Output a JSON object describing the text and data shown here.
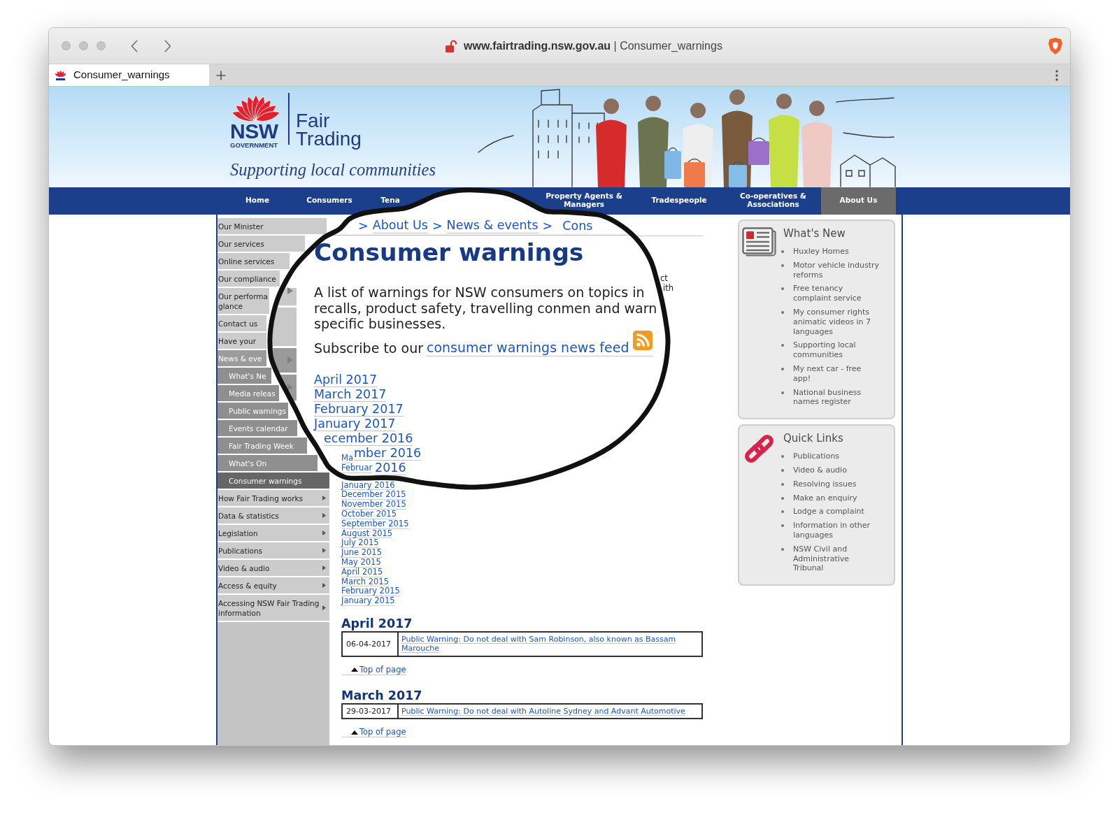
{
  "browser": {
    "address": {
      "domain": "www.fairtrading.nsw.gov.au",
      "separator": "|",
      "page": "Consumer_warnings"
    },
    "tabs": [
      {
        "title": "Consumer_warnings",
        "selected": true
      }
    ]
  },
  "header": {
    "logo_word": "NSW",
    "logo_subword": "GOVERNMENT",
    "agency_name_lines": [
      "Fair",
      "Trading"
    ],
    "tagline": "Supporting local communities"
  },
  "nav": [
    {
      "label": "Home",
      "selected": false
    },
    {
      "label": "Consumers",
      "selected": false
    },
    {
      "label": "Tena",
      "selected": false
    },
    {
      "label": "Property Agents & Managers",
      "selected": false
    },
    {
      "label": "Tradespeople",
      "selected": false
    },
    {
      "label": "Co-operatives & Associations",
      "selected": false
    },
    {
      "label": "About Us",
      "selected": true
    }
  ],
  "sidebar": [
    {
      "label": "Our Minister",
      "selected": false,
      "expanded": false,
      "has_submenu": false
    },
    {
      "label": "Our services",
      "selected": false,
      "expanded": false,
      "has_submenu": false
    },
    {
      "label": "Online services",
      "selected": false,
      "expanded": false,
      "has_submenu": false
    },
    {
      "label": "Our compliance",
      "selected": false,
      "expanded": false,
      "has_submenu": false
    },
    {
      "label": "Our performa\nglance",
      "selected": false,
      "expanded": false,
      "has_submenu": false
    },
    {
      "label": "Contact us",
      "selected": false,
      "expanded": false,
      "has_submenu": false
    },
    {
      "label": "Have your",
      "selected": false,
      "expanded": false,
      "has_submenu": false
    },
    {
      "label": "News & eve",
      "selected": false,
      "expanded": true,
      "has_submenu": false,
      "children": [
        {
          "label": "What's Ne",
          "selected": false
        },
        {
          "label": "Media releas",
          "selected": false
        },
        {
          "label": "Public warnings",
          "selected": false
        },
        {
          "label": "Events calendar",
          "selected": false
        },
        {
          "label": "Fair Trading Week",
          "selected": false
        },
        {
          "label": "What's On",
          "selected": false
        },
        {
          "label": "Consumer warnings",
          "selected": true
        }
      ]
    },
    {
      "label": "How Fair Trading works",
      "selected": false,
      "expanded": false,
      "has_submenu": true
    },
    {
      "label": "Data & statistics",
      "selected": false,
      "expanded": false,
      "has_submenu": true
    },
    {
      "label": "Legislation",
      "selected": false,
      "expanded": false,
      "has_submenu": true
    },
    {
      "label": "Publications",
      "selected": false,
      "expanded": false,
      "has_submenu": true
    },
    {
      "label": "Video & audio",
      "selected": false,
      "expanded": false,
      "has_submenu": true
    },
    {
      "label": "Access & equity",
      "selected": false,
      "expanded": false,
      "has_submenu": true
    },
    {
      "label": "Accessing NSW Fair Trading information",
      "selected": false,
      "expanded": false,
      "has_submenu": true
    }
  ],
  "magnifier": {
    "breadcrumb": [
      {
        "kind": "separator",
        "text": ">"
      },
      {
        "kind": "link",
        "text": "About Us"
      },
      {
        "kind": "separator",
        "text": ">"
      },
      {
        "kind": "link",
        "text": "News & events"
      },
      {
        "kind": "separator",
        "text": ">"
      },
      {
        "kind": "current",
        "text": "Cons"
      }
    ],
    "heading": "Consumer warnings",
    "intro_lines": [
      "A list of warnings for NSW consumers on topics in",
      "recalls, product safety, travelling conmen and warn",
      "specific businesses."
    ],
    "subscribe": {
      "text": "Subscribe to our",
      "link": "consumer warnings news feed"
    },
    "months": [
      "April 2017",
      "March 2017",
      "February 2017",
      "January 2017",
      "ecember 2016",
      "mber 2016",
      "2016"
    ]
  },
  "content": {
    "fragments": [
      "ct",
      "ith"
    ],
    "months": [
      "Ma",
      "Februar",
      "January 2016",
      "December 2015",
      "November 2015",
      "October 2015",
      "September 2015",
      "August 2015",
      "July 2015",
      "June 2015",
      "May 2015",
      "April 2015",
      "March 2015",
      "February 2015",
      "January 2015"
    ],
    "sections": [
      {
        "heading": "April 2017",
        "rows": [
          {
            "date": "06-04-2017",
            "title": "Public Warning: Do not deal with Sam Robinson, also known as Bassam Marouche"
          }
        ],
        "top_link": "Top of page"
      },
      {
        "heading": "March 2017",
        "rows": [
          {
            "date": "29-03-2017",
            "title": "Public Warning: Do not deal with Autoline Sydney and Advant Automotive"
          }
        ],
        "top_link": "Top of page"
      }
    ]
  },
  "panels": [
    {
      "kind": "news",
      "title": "What's New",
      "items": [
        "Huxley Homes",
        "Motor vehicle industry reforms",
        "Free tenancy complaint service",
        "My consumer rights animatic videos in 7 languages",
        "Supporting local communities",
        "My next car - free app!",
        "National business names register"
      ]
    },
    {
      "kind": "links",
      "title": "Quick Links",
      "items": [
        "Publications",
        "Video & audio",
        "Resolving issues",
        "Make an enquiry",
        "Lodge a complaint",
        "Information in other languages",
        "NSW Civil and Administrative Tribunal"
      ]
    }
  ]
}
